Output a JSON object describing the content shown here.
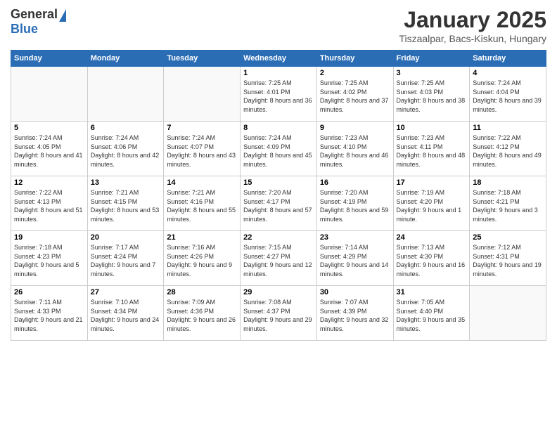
{
  "logo": {
    "general": "General",
    "blue": "Blue"
  },
  "title": "January 2025",
  "location": "Tiszaalpar, Bacs-Kiskun, Hungary",
  "weekdays": [
    "Sunday",
    "Monday",
    "Tuesday",
    "Wednesday",
    "Thursday",
    "Friday",
    "Saturday"
  ],
  "weeks": [
    [
      {
        "day": "",
        "info": ""
      },
      {
        "day": "",
        "info": ""
      },
      {
        "day": "",
        "info": ""
      },
      {
        "day": "1",
        "info": "Sunrise: 7:25 AM\nSunset: 4:01 PM\nDaylight: 8 hours and 36 minutes."
      },
      {
        "day": "2",
        "info": "Sunrise: 7:25 AM\nSunset: 4:02 PM\nDaylight: 8 hours and 37 minutes."
      },
      {
        "day": "3",
        "info": "Sunrise: 7:25 AM\nSunset: 4:03 PM\nDaylight: 8 hours and 38 minutes."
      },
      {
        "day": "4",
        "info": "Sunrise: 7:24 AM\nSunset: 4:04 PM\nDaylight: 8 hours and 39 minutes."
      }
    ],
    [
      {
        "day": "5",
        "info": "Sunrise: 7:24 AM\nSunset: 4:05 PM\nDaylight: 8 hours and 41 minutes."
      },
      {
        "day": "6",
        "info": "Sunrise: 7:24 AM\nSunset: 4:06 PM\nDaylight: 8 hours and 42 minutes."
      },
      {
        "day": "7",
        "info": "Sunrise: 7:24 AM\nSunset: 4:07 PM\nDaylight: 8 hours and 43 minutes."
      },
      {
        "day": "8",
        "info": "Sunrise: 7:24 AM\nSunset: 4:09 PM\nDaylight: 8 hours and 45 minutes."
      },
      {
        "day": "9",
        "info": "Sunrise: 7:23 AM\nSunset: 4:10 PM\nDaylight: 8 hours and 46 minutes."
      },
      {
        "day": "10",
        "info": "Sunrise: 7:23 AM\nSunset: 4:11 PM\nDaylight: 8 hours and 48 minutes."
      },
      {
        "day": "11",
        "info": "Sunrise: 7:22 AM\nSunset: 4:12 PM\nDaylight: 8 hours and 49 minutes."
      }
    ],
    [
      {
        "day": "12",
        "info": "Sunrise: 7:22 AM\nSunset: 4:13 PM\nDaylight: 8 hours and 51 minutes."
      },
      {
        "day": "13",
        "info": "Sunrise: 7:21 AM\nSunset: 4:15 PM\nDaylight: 8 hours and 53 minutes."
      },
      {
        "day": "14",
        "info": "Sunrise: 7:21 AM\nSunset: 4:16 PM\nDaylight: 8 hours and 55 minutes."
      },
      {
        "day": "15",
        "info": "Sunrise: 7:20 AM\nSunset: 4:17 PM\nDaylight: 8 hours and 57 minutes."
      },
      {
        "day": "16",
        "info": "Sunrise: 7:20 AM\nSunset: 4:19 PM\nDaylight: 8 hours and 59 minutes."
      },
      {
        "day": "17",
        "info": "Sunrise: 7:19 AM\nSunset: 4:20 PM\nDaylight: 9 hours and 1 minute."
      },
      {
        "day": "18",
        "info": "Sunrise: 7:18 AM\nSunset: 4:21 PM\nDaylight: 9 hours and 3 minutes."
      }
    ],
    [
      {
        "day": "19",
        "info": "Sunrise: 7:18 AM\nSunset: 4:23 PM\nDaylight: 9 hours and 5 minutes."
      },
      {
        "day": "20",
        "info": "Sunrise: 7:17 AM\nSunset: 4:24 PM\nDaylight: 9 hours and 7 minutes."
      },
      {
        "day": "21",
        "info": "Sunrise: 7:16 AM\nSunset: 4:26 PM\nDaylight: 9 hours and 9 minutes."
      },
      {
        "day": "22",
        "info": "Sunrise: 7:15 AM\nSunset: 4:27 PM\nDaylight: 9 hours and 12 minutes."
      },
      {
        "day": "23",
        "info": "Sunrise: 7:14 AM\nSunset: 4:29 PM\nDaylight: 9 hours and 14 minutes."
      },
      {
        "day": "24",
        "info": "Sunrise: 7:13 AM\nSunset: 4:30 PM\nDaylight: 9 hours and 16 minutes."
      },
      {
        "day": "25",
        "info": "Sunrise: 7:12 AM\nSunset: 4:31 PM\nDaylight: 9 hours and 19 minutes."
      }
    ],
    [
      {
        "day": "26",
        "info": "Sunrise: 7:11 AM\nSunset: 4:33 PM\nDaylight: 9 hours and 21 minutes."
      },
      {
        "day": "27",
        "info": "Sunrise: 7:10 AM\nSunset: 4:34 PM\nDaylight: 9 hours and 24 minutes."
      },
      {
        "day": "28",
        "info": "Sunrise: 7:09 AM\nSunset: 4:36 PM\nDaylight: 9 hours and 26 minutes."
      },
      {
        "day": "29",
        "info": "Sunrise: 7:08 AM\nSunset: 4:37 PM\nDaylight: 9 hours and 29 minutes."
      },
      {
        "day": "30",
        "info": "Sunrise: 7:07 AM\nSunset: 4:39 PM\nDaylight: 9 hours and 32 minutes."
      },
      {
        "day": "31",
        "info": "Sunrise: 7:05 AM\nSunset: 4:40 PM\nDaylight: 9 hours and 35 minutes."
      },
      {
        "day": "",
        "info": ""
      }
    ]
  ]
}
